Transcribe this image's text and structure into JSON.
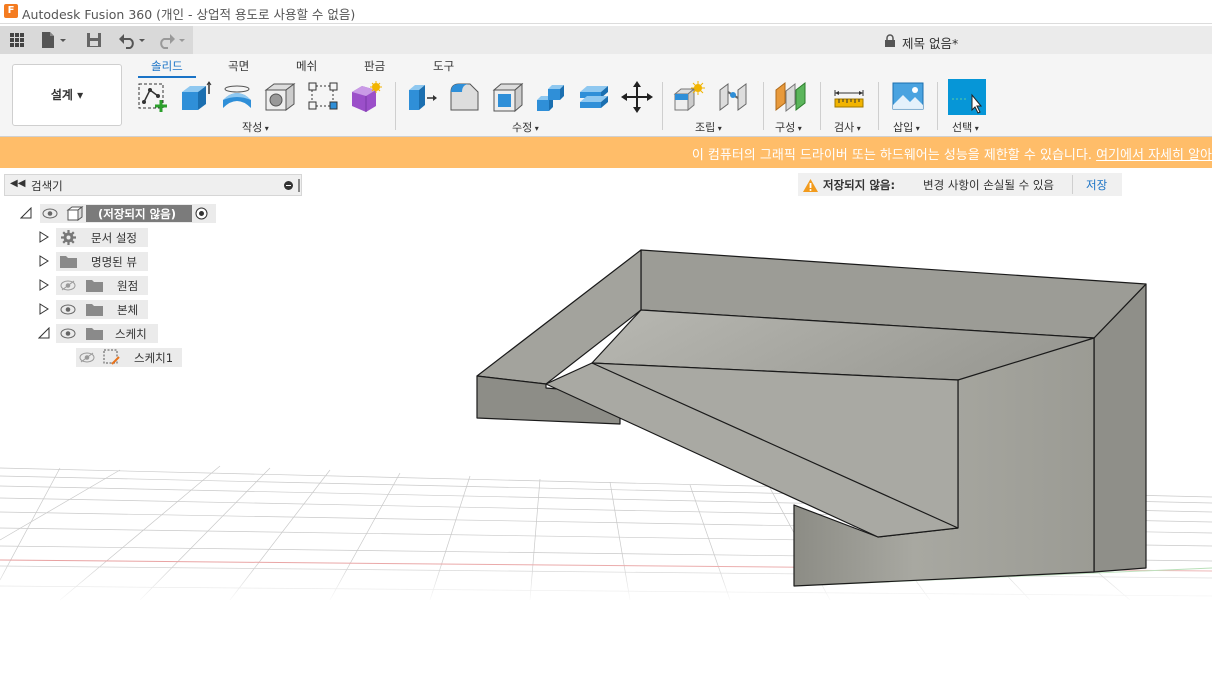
{
  "window": {
    "title": "Autodesk Fusion 360 (개인 - 상업적 용도로 사용할 수 없음)"
  },
  "document": {
    "title": "제목 없음*"
  },
  "quick_access": {
    "icons": [
      "apps-grid-icon",
      "file-icon",
      "save-icon",
      "undo-icon",
      "redo-icon"
    ]
  },
  "ribbon": {
    "workspace": "설계 ▾",
    "tabs": [
      "솔리드",
      "곡면",
      "메쉬",
      "판금",
      "도구"
    ],
    "active_tab": "솔리드",
    "groups": {
      "create": "작성",
      "modify": "수정",
      "assemble": "조립",
      "construct": "구성",
      "inspect": "검사",
      "insert": "삽입",
      "select": "선택"
    }
  },
  "banner": {
    "text": "이 컴퓨터의 그래픽 드라이버 또는 하드웨어는 성능을 제한할 수 있습니다.",
    "link": "여기에서 자세히 알아"
  },
  "browser": {
    "title": "검색기",
    "root": "(저장되지 않음)",
    "items": [
      "문서 설정",
      "명명된 뷰",
      "원점",
      "본체",
      "스케치"
    ],
    "sketch_child": "스케치1"
  },
  "save_warning": {
    "label": "저장되지 않음:",
    "message": "변경 사항이 손실될 수 있음",
    "action": "저장"
  },
  "colors": {
    "accent": "#1a73c6",
    "banner": "#ffbd69",
    "logo": "#f47b20",
    "select_tool": "#0696d7",
    "body_face": "#9a9a93"
  }
}
